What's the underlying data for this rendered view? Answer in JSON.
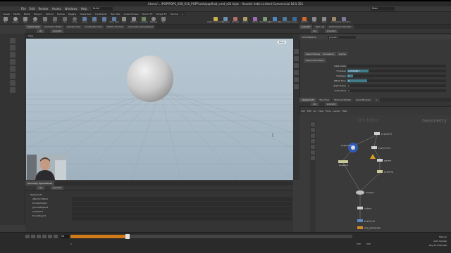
{
  "window": {
    "title": "/Users/... /POP/POPS_058_010_POPFluids/popfluid_cmd_v01.hiplc - Houdini Indie Limited-Commercial 18.5.351"
  },
  "menu": {
    "items": [
      "File",
      "Edit",
      "Render",
      "Assets",
      "Windows",
      "Help"
    ],
    "desktop": "Build",
    "build": "Main"
  },
  "shelf": {
    "tabs": [
      "Create",
      "Modify",
      "Model",
      "Polygon",
      "Deform",
      "Texture",
      "Rigging",
      "Characters",
      "Constraints",
      "Hair Utils",
      "Guide Process",
      "Terrain FX",
      "Simple FX",
      "Volume",
      "+"
    ],
    "tools": [
      "Box",
      "Sphere",
      "Tube",
      "Torus",
      "Grid",
      "Null",
      "Line",
      "Circle",
      "Curve",
      "Draw",
      "Path",
      "Spray Paint",
      "Font",
      "Platonic",
      "L-System",
      "Metaball",
      "File"
    ],
    "right_tools": [
      "Lights and Cameras",
      "Collisions",
      "Particles",
      "Grains",
      "Vellum",
      "Rigid Bodies",
      "Particle Fluids",
      "Viscous Fluids",
      "Oceans",
      "Pyro FX",
      "FEM",
      "Wires",
      "Crowds",
      "Drive Simulation"
    ]
  },
  "viewer": {
    "tabs": [
      "Scene View",
      "Animation Editor",
      "Render View",
      "Composite View",
      "Motion FX View",
      "Geometry Spreadsheet"
    ],
    "path": "obj",
    "node": "popnet1",
    "view_label": "View",
    "camera_menu": "Persp",
    "cam_button": "No cam"
  },
  "params": {
    "tabs": [
      "popnet1",
      "Take List",
      "Performance Monitor"
    ],
    "path": "obj",
    "node": "popnet1",
    "node_type": "DOP Network",
    "node_name": "popnet1",
    "section_tabs": [
      "Object Merge",
      "Simulation",
      "Cache"
    ],
    "reset_btn": "Reset Simulation",
    "rows": [
      {
        "label": "Initial State",
        "value": ""
      },
      {
        "label": "Timestep",
        "value": "0.0416667"
      },
      {
        "label": "Substeps",
        "value": "1"
      },
      {
        "label": "Offset Time",
        "value": "0"
      },
      {
        "label": "Start Frame",
        "value": "1"
      },
      {
        "label": "Scale Time",
        "value": "1"
      }
    ]
  },
  "network": {
    "tabs": [
      "obj/popnet1",
      "Tree View",
      "Material Palette",
      "Asset Browser",
      "+"
    ],
    "path": "obj",
    "node": "popnet1",
    "menu": [
      "Add",
      "Edit",
      "Go",
      "View",
      "Tools",
      "Layout",
      "Help"
    ],
    "context_left": "Sim Editor",
    "context": "Geometry",
    "nodes": [
      "popobject",
      "popsolver",
      "popsource1",
      "sphere",
      "popwind",
      "popdrag",
      "merge1",
      "output",
      "popforce1",
      "POP_NETWORK"
    ]
  },
  "dopnet_tree": {
    "path": "obj",
    "node": "popnet1",
    "rows": [
      "obj/popnet1",
      "Affector Matrix",
      "forceActivator",
      "groundObject1",
      "popobject",
      "forceObject1"
    ]
  },
  "timeline": {
    "frame": "58",
    "start": "1",
    "end": "240",
    "end_field": "240",
    "right_info": [
      "Manual",
      "Auto Update",
      "Key All Channels"
    ]
  },
  "colors": {
    "viewport_top": "#b9c9d4",
    "viewport_bottom": "#9fb1bf",
    "timeline_played": "#d07a1a",
    "param_value": "#3f7d8a",
    "node_selected": "#2f60c8",
    "node_warning": "#d8a020"
  }
}
